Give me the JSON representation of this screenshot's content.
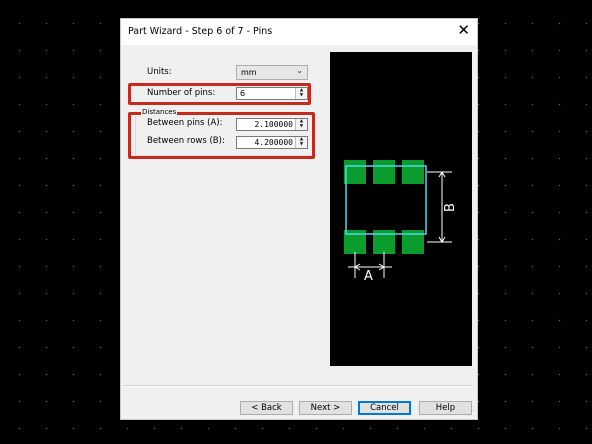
{
  "window": {
    "title": "Part Wizard - Step 6 of 7 - Pins",
    "close_glyph": "✕"
  },
  "form": {
    "units_label": "Units:",
    "units_value": "mm",
    "pins_label": "Number of pins:",
    "pins_value": "6",
    "distances_label": "Distances",
    "between_pins_label": "Between pins (A):",
    "between_pins_value": "2.100000",
    "between_rows_label": "Between rows (B):",
    "between_rows_value": "4.200000"
  },
  "preview": {
    "label_a": "A",
    "label_b": "B"
  },
  "buttons": {
    "back": "< Back",
    "next": "Next >",
    "cancel": "Cancel",
    "help": "Help"
  },
  "colors": {
    "highlight": "#c42b1c",
    "pad": "#0a9d2e",
    "outline": "#4dd9e8",
    "dimension": "#ffffff",
    "preview_bg": "#000000"
  },
  "icons": {
    "dropdown": "chevron-down-icon",
    "spin_up": "spin-up-icon",
    "spin_down": "spin-down-icon",
    "close": "close-icon"
  }
}
